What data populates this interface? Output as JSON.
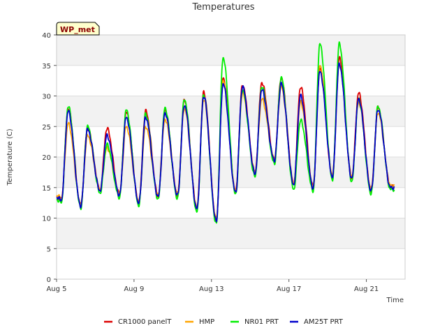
{
  "chart_data": {
    "type": "line",
    "title": "Temperatures",
    "xlabel": "Time",
    "ylabel": "Temperature (C)",
    "badge": "WP_met",
    "x_start_label": "Aug 5",
    "x_end_label": "Aug 23",
    "xlim": [
      "Aug 5",
      "Aug 23"
    ],
    "ylim": [
      0,
      40
    ],
    "x_ticks": [
      "Aug 5",
      "Aug 9",
      "Aug 13",
      "Aug 17",
      "Aug 21"
    ],
    "y_ticks": [
      0,
      5,
      10,
      15,
      20,
      25,
      30,
      35,
      40
    ],
    "grid": true,
    "background_bands": true,
    "legend_position": "bottom",
    "base_profile": {
      "lows": [
        13.0,
        12.0,
        14.5,
        13.8,
        12.5,
        13.5,
        13.7,
        11.5,
        9.5,
        14.2,
        17.3,
        19.5,
        15.5,
        15.0,
        16.8,
        16.5,
        14.5,
        15.0
      ],
      "highs": [
        27.5,
        24.5,
        23.5,
        26.5,
        26.5,
        27.2,
        28.5,
        30.0,
        32.0,
        31.5,
        31.0,
        32.0,
        30.0,
        34.0,
        35.2,
        29.5,
        27.8
      ]
    },
    "series": [
      {
        "name": "CR1000 panelT",
        "color": "#dd0000",
        "high_offsets": [
          0.5,
          0.3,
          1.2,
          0.8,
          1.0,
          0.4,
          0.8,
          0.6,
          1.0,
          0.3,
          1.2,
          1.0,
          1.5,
          0.5,
          1.0,
          1.0,
          0.3
        ],
        "low_offsets": [
          0.1,
          0.1,
          0.1,
          0.1,
          0.1,
          0.1,
          0.1,
          0.1,
          0.1,
          0.1,
          0.1,
          0.1,
          0.1,
          0.1,
          0.1,
          0.1,
          0.1,
          0.1
        ]
      },
      {
        "name": "HMP",
        "color": "#ffa500",
        "high_offsets": [
          -2.0,
          -1.0,
          -2.0,
          -1.5,
          -1.5,
          -1.0,
          -0.5,
          -0.5,
          0.5,
          -1.0,
          -1.5,
          -0.5,
          -1.0,
          1.0,
          0.0,
          -0.5,
          -0.5
        ],
        "low_offsets": [
          0.3,
          0.3,
          0.3,
          0.3,
          0.3,
          0.3,
          0.3,
          0.3,
          0.3,
          0.3,
          0.3,
          0.3,
          0.3,
          0.3,
          0.3,
          0.3,
          0.3,
          0.3
        ]
      },
      {
        "name": "NR01 PRT",
        "color": "#00ee00",
        "high_offsets": [
          0.8,
          0.5,
          -1.5,
          1.2,
          0.5,
          0.8,
          1.0,
          0.2,
          4.3,
          -0.5,
          0.5,
          1.0,
          -4.0,
          4.5,
          3.3,
          0.0,
          0.5
        ],
        "low_offsets": [
          -0.4,
          -0.3,
          -0.4,
          -0.4,
          -0.4,
          -0.4,
          -0.5,
          -0.5,
          -0.5,
          -0.4,
          -0.5,
          -0.6,
          -0.8,
          -0.5,
          -0.5,
          -0.5,
          -0.5,
          -0.3
        ]
      },
      {
        "name": "AM25T PRT",
        "color": "#0000cc",
        "high_offsets": [
          0.0,
          0.0,
          0.0,
          0.0,
          0.0,
          0.0,
          0.0,
          0.0,
          0.0,
          0.0,
          0.0,
          0.0,
          0.0,
          0.0,
          0.0,
          0.0,
          0.0
        ],
        "low_offsets": [
          0.0,
          0.0,
          0.0,
          0.0,
          0.0,
          0.0,
          0.0,
          0.0,
          0.0,
          0.0,
          0.0,
          0.0,
          0.0,
          0.0,
          0.0,
          0.0,
          0.0,
          0.0
        ]
      }
    ]
  }
}
